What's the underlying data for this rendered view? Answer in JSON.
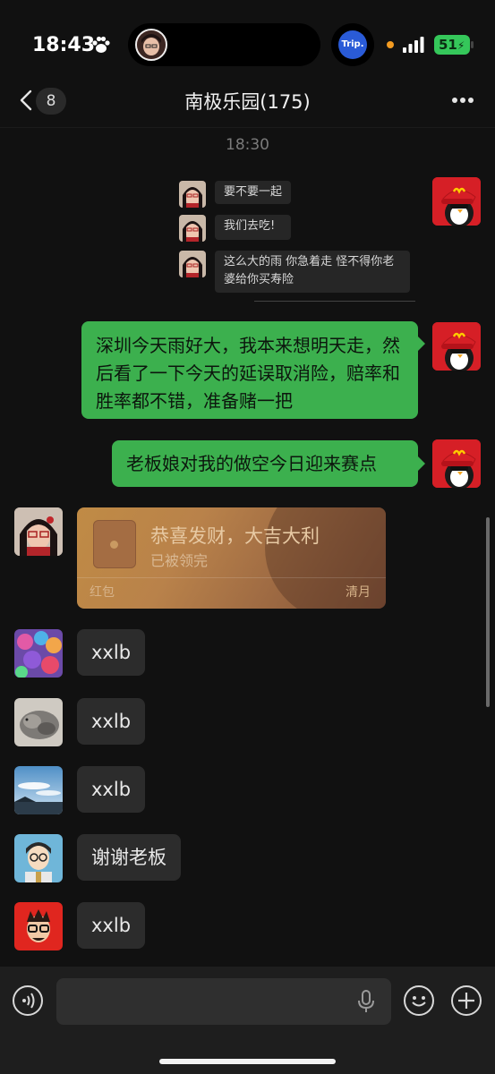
{
  "status_bar": {
    "time": "18:43",
    "trip_label": "Trip.",
    "battery": "51"
  },
  "nav": {
    "unread_count": "8",
    "title": "南极乐园(175)"
  },
  "timestamp": "18:30",
  "quoted_messages": [
    {
      "text": "要不要一起"
    },
    {
      "text": "我们去吃!"
    },
    {
      "text": "这么大的雨 你急着走 怪不得你老婆给你买寿险"
    }
  ],
  "sent_messages": [
    {
      "text": "深圳今天雨好大，我本来想明天走，然后看了一下今天的延误取消险，赔率和胜率都不错，准备赌一把"
    },
    {
      "text": "老板娘对我的做空今日迎来赛点"
    }
  ],
  "red_packet": {
    "title": "恭喜发财，大吉大利",
    "status": "已被领完",
    "label": "红包",
    "sender": "清月"
  },
  "received_messages": [
    {
      "text": "xxlb",
      "avatar": "colorful-balloons-avatar"
    },
    {
      "text": "xxlb",
      "avatar": "cat-avatar"
    },
    {
      "text": "xxlb",
      "avatar": "sky-lake-avatar"
    },
    {
      "text": "谢谢老板",
      "avatar": "cartoon-boy-avatar"
    },
    {
      "text": "xxlb",
      "avatar": "red-glasses-avatar"
    }
  ],
  "colors": {
    "sent_bubble": "#3cb04e",
    "received_bubble": "#2c2c2c",
    "background": "#111111"
  }
}
